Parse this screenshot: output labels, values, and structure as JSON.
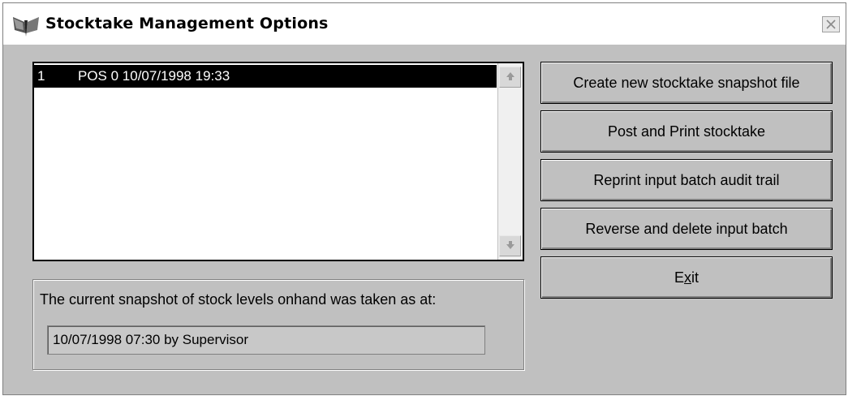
{
  "window": {
    "title": "Stocktake Management Options",
    "close_label": "×"
  },
  "batch_list": {
    "items": [
      {
        "number": "1",
        "text": "POS 0 10/07/1998 19:33",
        "selected": true
      }
    ]
  },
  "snapshot": {
    "label": "The current snapshot of stock levels onhand was taken as at:",
    "value": "10/07/1998 07:30 by Supervisor"
  },
  "actions": {
    "create_snapshot": "Create new stocktake snapshot file",
    "post_print": "Post and Print stocktake",
    "reprint_audit": "Reprint input batch audit trail",
    "reverse_delete": "Reverse and delete input batch",
    "exit_prefix": "E",
    "exit_accel": "x",
    "exit_suffix": "it"
  },
  "icons": {
    "app": "moth-logo-icon",
    "close": "close-icon",
    "scroll_up": "scroll-up-arrow-icon",
    "scroll_down": "scroll-down-arrow-icon"
  },
  "colors": {
    "window_bg": "#c0c0c0",
    "selection_bg": "#000000",
    "selection_text": "#ffffff"
  }
}
